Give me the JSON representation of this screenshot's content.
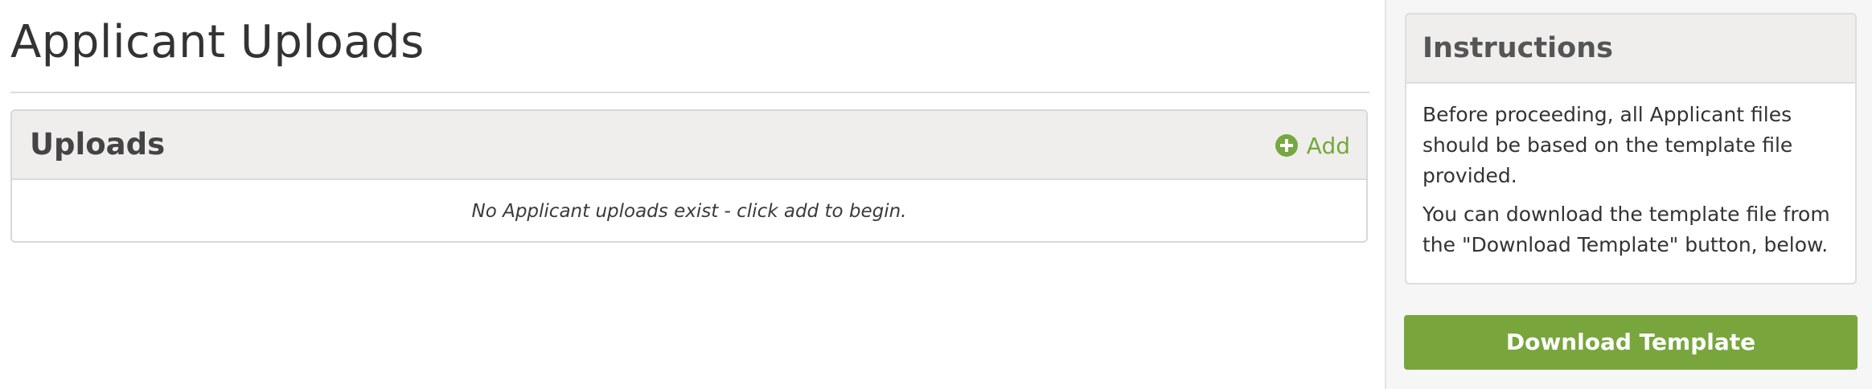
{
  "page": {
    "title": "Applicant Uploads"
  },
  "uploads": {
    "title": "Uploads",
    "add_label": "Add",
    "add_icon": "plus-circle-icon",
    "empty_message": "No Applicant uploads exist - click add to begin."
  },
  "sidebar": {
    "instructions_title": "Instructions",
    "paragraphs": [
      "Before proceeding, all Applicant files should be based on the template file provided.",
      "You can download the template file from the \"Download Template\" button, below."
    ],
    "download_label": "Download Template"
  },
  "colors": {
    "accent_green": "#78a63d",
    "panel_header_bg": "#efeeec",
    "sidebar_bg": "#f6f6f6"
  }
}
